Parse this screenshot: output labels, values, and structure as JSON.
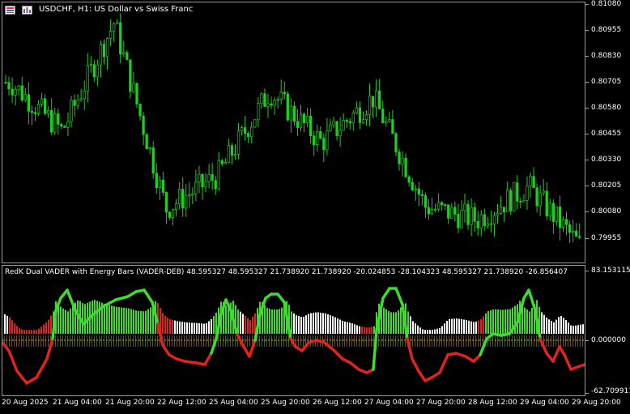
{
  "chart": {
    "symbol_title": "USDCHF, H1:  US Dollar vs Swiss Franc",
    "price_axis": [
      "0.81080",
      "0.80955",
      "0.80830",
      "0.80705",
      "0.80580",
      "0.80455",
      "0.80330",
      "0.80205",
      "0.80080",
      "0.79955"
    ],
    "candle_color": "#22cc22",
    "background": "#000000"
  },
  "indicator": {
    "title": "RedK Dual VADER with Energy Bars (VADER-DEB)",
    "values": "48.595327 48.595327 21.738920 21.738920 -20.024853 -28.104323 48.595327 21.738920 -26.856407",
    "axis_labels": [
      "83.153115",
      "0.000000",
      "-62.709911"
    ],
    "colors": {
      "green": "#3ddc2e",
      "red": "#e0231f",
      "white": "#ffffff",
      "zero_line": "#c8c800"
    }
  },
  "time_axis": [
    "20 Aug 2025",
    "21 Aug 04:00",
    "21 Aug 20:00",
    "22 Aug 12:00",
    "25 Aug 04:00",
    "25 Aug 20:00",
    "26 Aug 12:00",
    "27 Aug 04:00",
    "27 Aug 20:00",
    "28 Aug 12:00",
    "29 Aug 04:00",
    "29 Aug 20:00"
  ],
  "chart_data": {
    "type": "line",
    "title": "USDCHF, H1:  US Dollar vs Swiss Franc",
    "x": [
      "20 Aug 2025",
      "21 Aug 04:00",
      "21 Aug 20:00",
      "22 Aug 12:00",
      "25 Aug 04:00",
      "25 Aug 20:00",
      "26 Aug 12:00",
      "27 Aug 04:00",
      "27 Aug 20:00",
      "28 Aug 12:00",
      "29 Aug 04:00",
      "29 Aug 20:00"
    ],
    "series": [
      {
        "name": "USDCHF, H1",
        "values": [
          0.8072,
          0.805,
          0.8099,
          0.8015,
          0.803,
          0.8068,
          0.8045,
          0.8065,
          0.8016,
          0.801,
          0.8025,
          0.7998
        ]
      }
    ],
    "ylim": [
      0.799,
      0.8108
    ]
  }
}
